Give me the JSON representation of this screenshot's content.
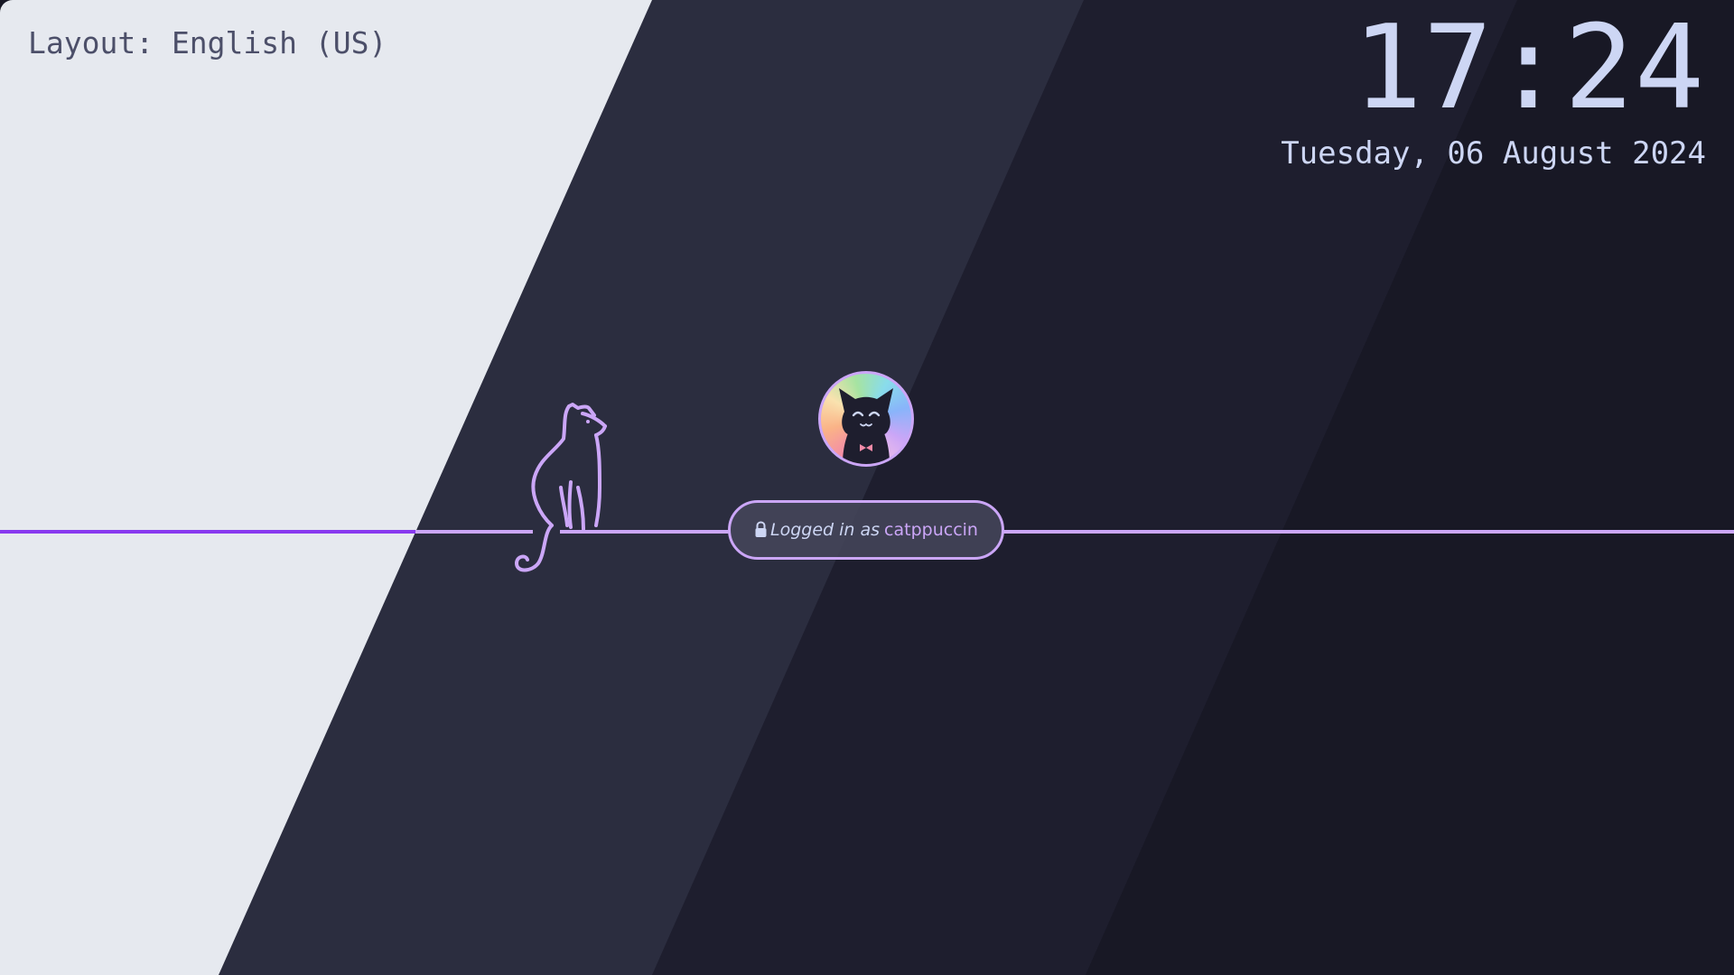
{
  "keyboard": {
    "layout_label": "Layout: English (US)"
  },
  "clock": {
    "time": "17:24",
    "date": "Tuesday, 06 August 2024"
  },
  "login": {
    "prefix": "Logged in as",
    "username": "catppuccin",
    "lock_icon": "lock-icon"
  },
  "avatar": {
    "icon": "cat-avatar-icon"
  },
  "decoration": {
    "cat_icon": "cat-outline-icon"
  },
  "colors": {
    "base_light": "#e6e9ef",
    "surface_dark": "#2b2d3f",
    "mantle": "#1e1e2e",
    "crust": "#181825",
    "accent_mauve": "#cba6f7",
    "accent_violet": "#8839ef",
    "text": "#cdd6f4",
    "text_dark": "#4c4f69"
  }
}
